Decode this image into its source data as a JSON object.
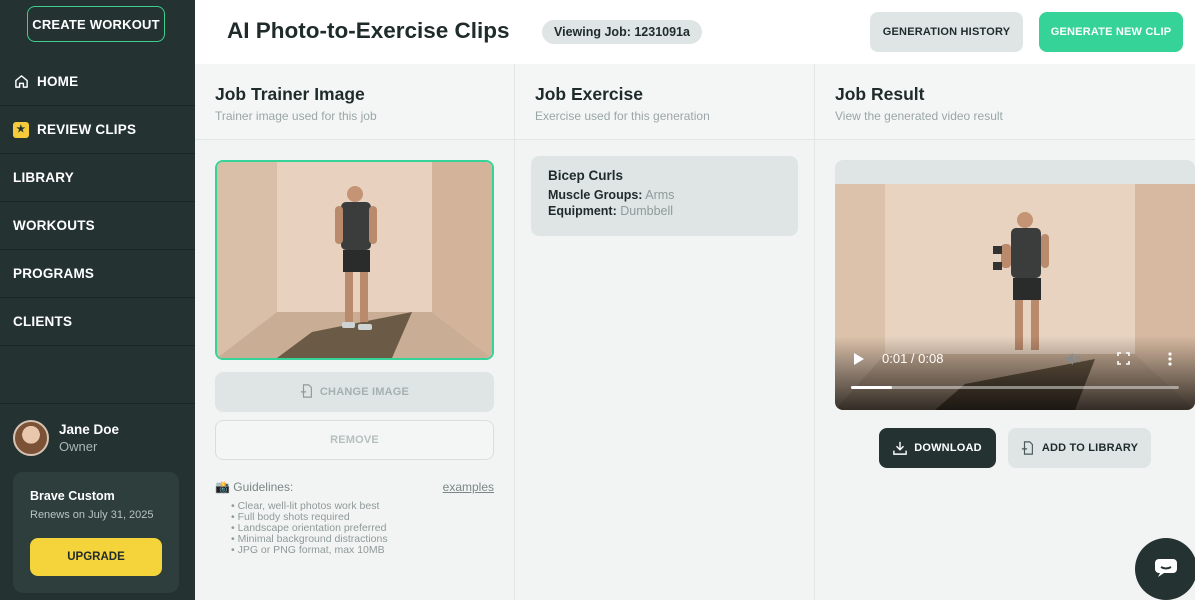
{
  "sidebar": {
    "create_workout": "CREATE WORKOUT",
    "items": [
      {
        "label": "HOME",
        "icon": "home-icon"
      },
      {
        "label": "REVIEW CLIPS",
        "icon": "star-icon"
      },
      {
        "label": "LIBRARY"
      },
      {
        "label": "WORKOUTS"
      },
      {
        "label": "PROGRAMS"
      },
      {
        "label": "CLIENTS"
      }
    ],
    "user": {
      "name": "Jane Doe",
      "role": "Owner"
    },
    "plan": {
      "name": "Brave Custom",
      "renews": "Renews on July 31, 2025",
      "upgrade_label": "UPGRADE"
    }
  },
  "header": {
    "title": "AI Photo-to-Exercise Clips",
    "job_badge": "Viewing Job: 1231091a",
    "history_label": "GENERATION HISTORY",
    "generate_label": "GENERATE NEW CLIP"
  },
  "trainer": {
    "title": "Job Trainer Image",
    "subtitle": "Trainer image used for this job",
    "change_label": "CHANGE IMAGE",
    "remove_label": "REMOVE",
    "guidelines_label": "📸 Guidelines:",
    "examples_label": "examples",
    "guidelines": [
      "• Clear, well-lit photos work best",
      "• Full body shots required",
      "• Landscape orientation preferred",
      "• Minimal background distractions",
      "• JPG or PNG format, max 10MB"
    ]
  },
  "exercise": {
    "title": "Job Exercise",
    "subtitle": "Exercise used for this generation",
    "name": "Bicep Curls",
    "muscle_label": "Muscle Groups:",
    "muscle_value": "Arms",
    "equipment_label": "Equipment:",
    "equipment_value": "Dumbbell"
  },
  "result": {
    "title": "Job Result",
    "subtitle": "View the generated video result",
    "time": "0:01 / 0:08",
    "progress": 0.125,
    "download_label": "DOWNLOAD",
    "library_label": "ADD TO LIBRARY"
  },
  "colors": {
    "sidebar_bg": "#243332",
    "accent_green": "#36d399",
    "upgrade_yellow": "#f5d33b"
  }
}
